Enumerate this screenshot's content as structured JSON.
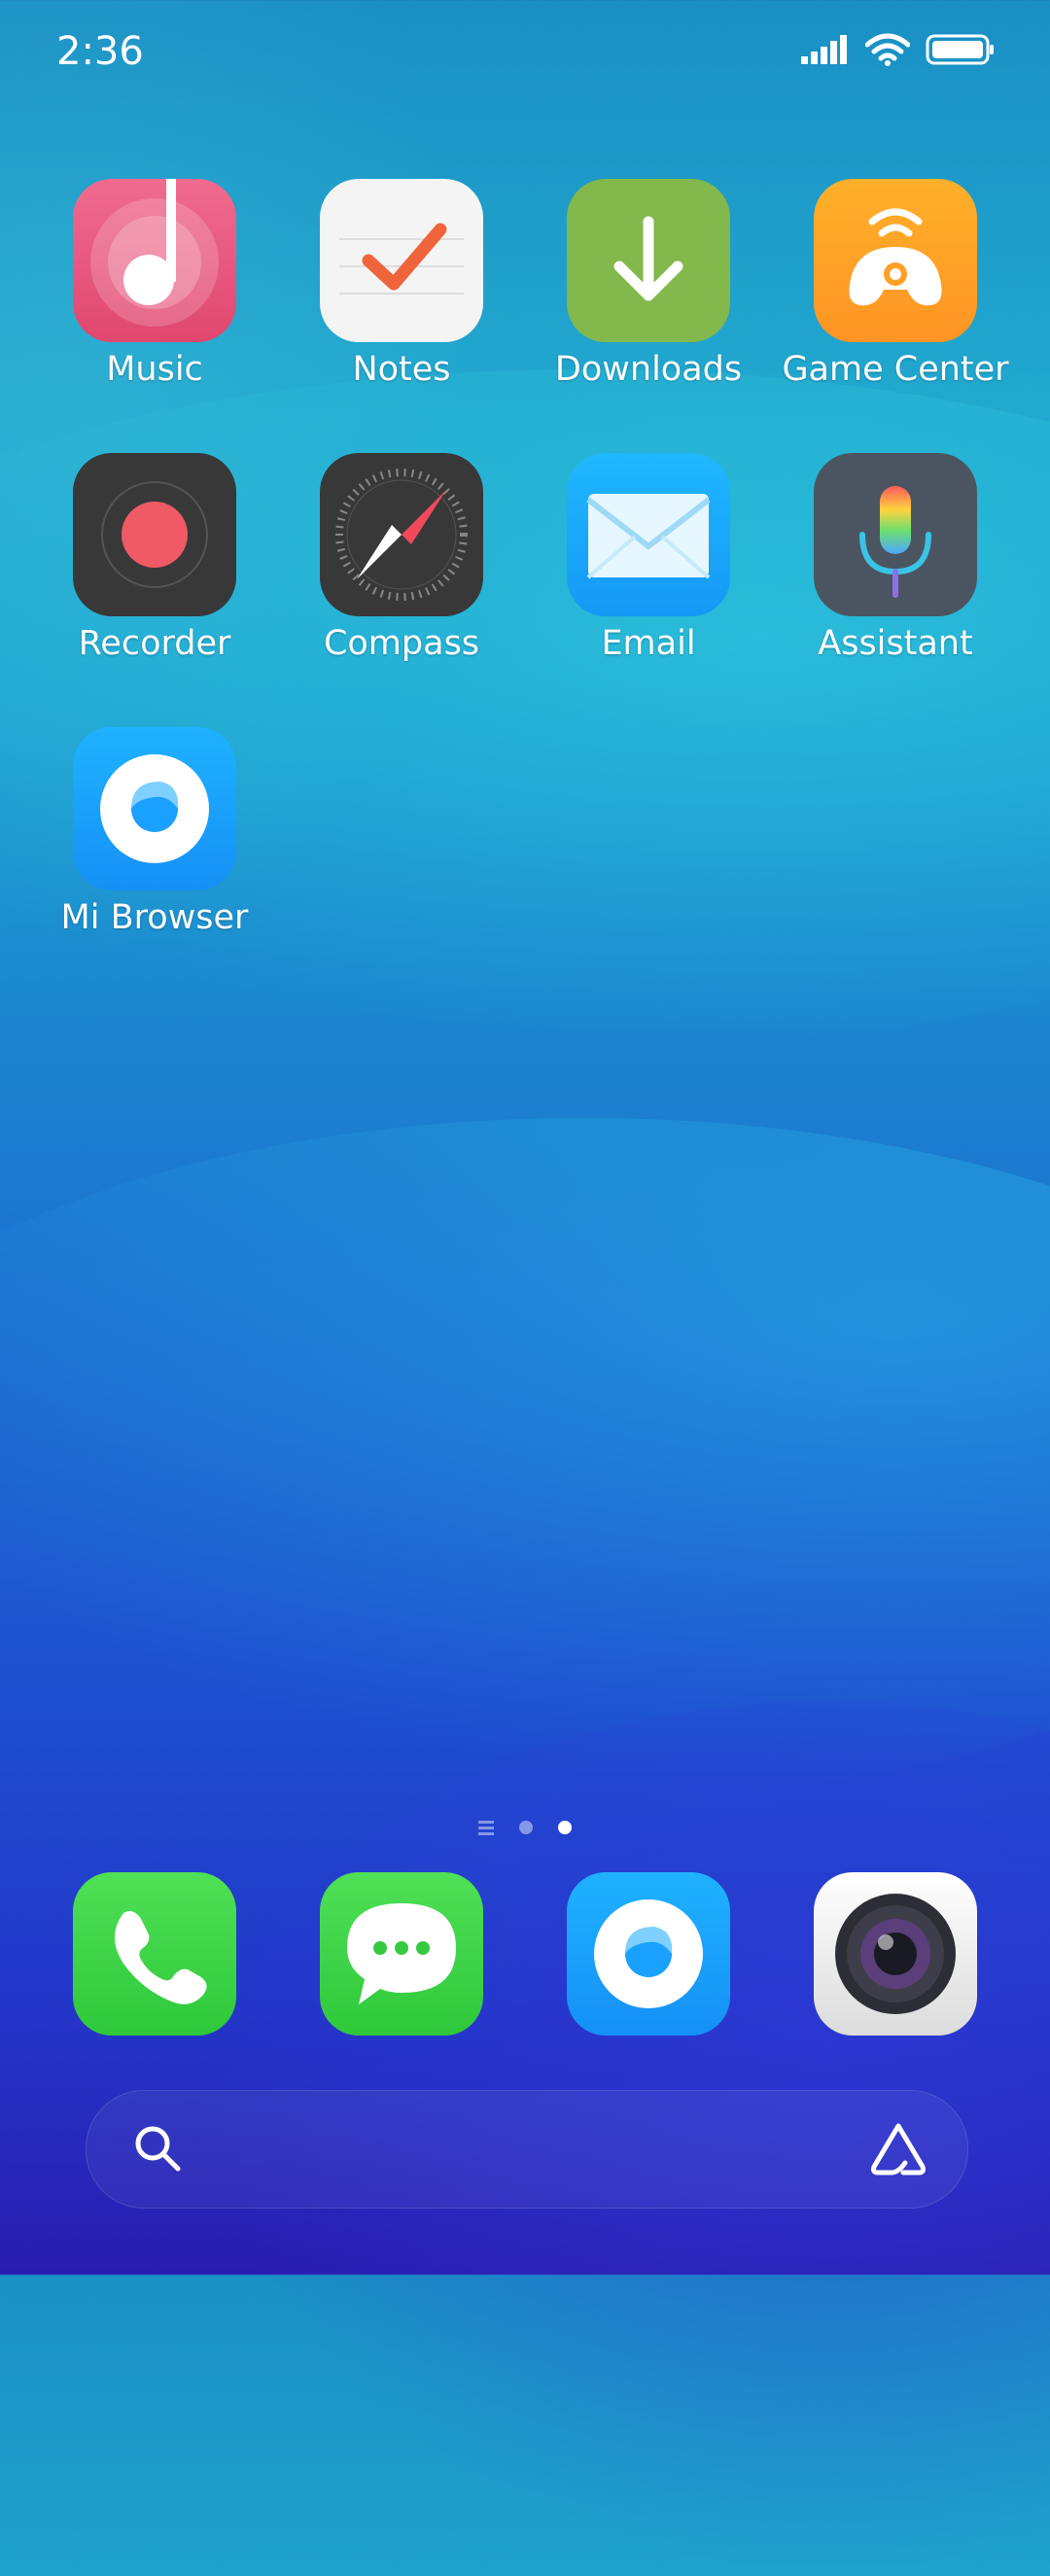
{
  "status_bar": {
    "time": "2:36"
  },
  "apps": [
    {
      "label": "Music",
      "icon": "music-icon"
    },
    {
      "label": "Notes",
      "icon": "notes-icon"
    },
    {
      "label": "Downloads",
      "icon": "downloads-icon"
    },
    {
      "label": "Game Center",
      "icon": "game-center-icon"
    },
    {
      "label": "Recorder",
      "icon": "recorder-icon"
    },
    {
      "label": "Compass",
      "icon": "compass-icon"
    },
    {
      "label": "Email",
      "icon": "email-icon"
    },
    {
      "label": "Assistant",
      "icon": "assistant-icon"
    },
    {
      "label": "Mi Browser",
      "icon": "mi-browser-icon"
    }
  ],
  "dock": [
    {
      "icon": "phone-icon"
    },
    {
      "icon": "messages-icon"
    },
    {
      "icon": "mi-browser-icon"
    },
    {
      "icon": "camera-icon"
    }
  ],
  "pager": {
    "pages": 3,
    "active": 3
  },
  "search_bar": {
    "left_icon": "search-icon",
    "right_icon": "assistant-a-icon"
  }
}
